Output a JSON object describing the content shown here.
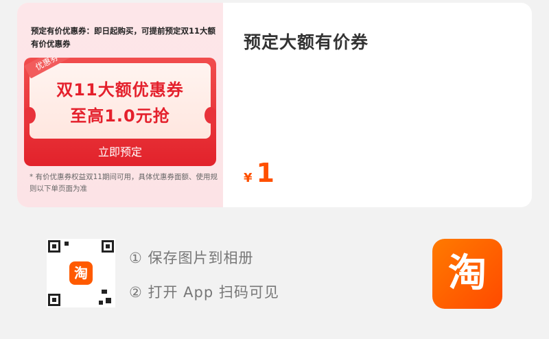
{
  "promo": {
    "header": "预定有价优惠券：即日起购买，可提前预定双11大额有价优惠券",
    "ticket_tag": "优惠券",
    "ticket_title": "双11大额优惠券",
    "ticket_subtitle": "至高1.0元抢",
    "reserve_button": "立即预定",
    "footnote": "* 有价优惠券权益双11期间可用，具体优惠券面额、使用规则以下单页面为准"
  },
  "product": {
    "title": "预定大额有价券",
    "currency": "¥",
    "price": "1"
  },
  "share": {
    "qr_logo": "淘",
    "step1": "① 保存图片到相册",
    "step2": "② 打开 App 扫码可见",
    "app_logo": "淘"
  },
  "colors": {
    "accent": "#ff5000",
    "ticket_red": "#e4202c",
    "app_orange": "#ff5a00"
  }
}
